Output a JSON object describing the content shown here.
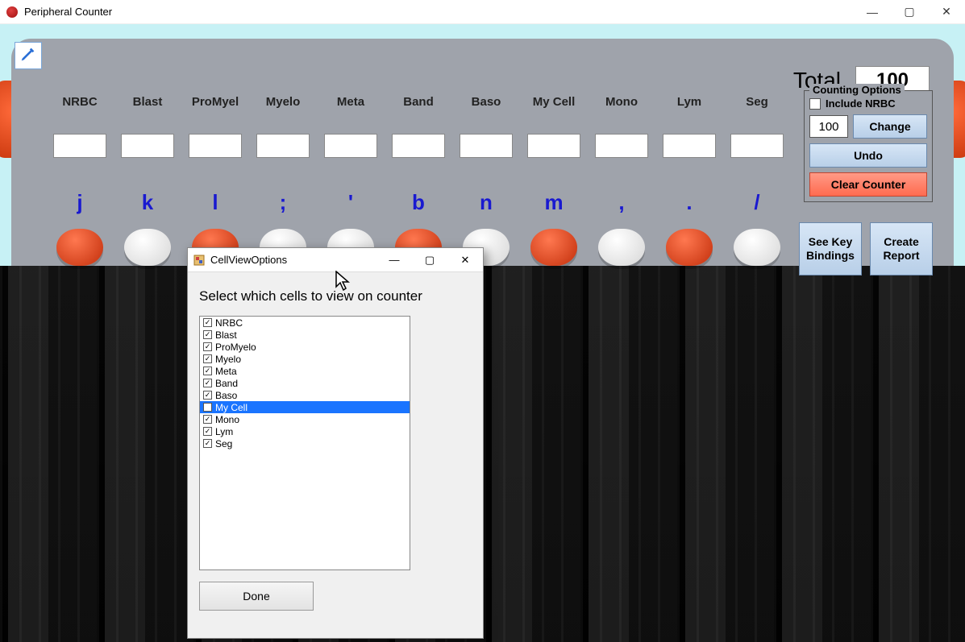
{
  "window": {
    "title": "Peripheral Counter",
    "controls": {
      "min": "—",
      "max": "▢",
      "close": "✕"
    }
  },
  "total": {
    "label": "Total",
    "value": "100"
  },
  "cells": [
    {
      "label": "NRBC",
      "key": "j",
      "btn": "red"
    },
    {
      "label": "Blast",
      "key": "k",
      "btn": "white"
    },
    {
      "label": "ProMyel",
      "key": "l",
      "btn": "red"
    },
    {
      "label": "Myelo",
      "key": ";",
      "btn": "white"
    },
    {
      "label": "Meta",
      "key": "'",
      "btn": "white"
    },
    {
      "label": "Band",
      "key": "b",
      "btn": "red"
    },
    {
      "label": "Baso",
      "key": "n",
      "btn": "white"
    },
    {
      "label": "My Cell",
      "key": "m",
      "btn": "red"
    },
    {
      "label": "Mono",
      "key": ",",
      "btn": "white"
    },
    {
      "label": "Lym",
      "key": ".",
      "btn": "red"
    },
    {
      "label": "Seg",
      "key": "/",
      "btn": "white"
    }
  ],
  "options": {
    "legend": "Counting Options",
    "include_nrbc_label": "Include NRBC",
    "count_target": "100",
    "change_label": "Change",
    "undo_label": "Undo",
    "clear_label": "Clear Counter"
  },
  "big_buttons": {
    "key_bindings": "See Key\nBindings",
    "create_report": "Create\nReport"
  },
  "dialog": {
    "title": "CellViewOptions",
    "heading": "Select which cells to view on counter",
    "items": [
      {
        "label": "NRBC",
        "checked": true,
        "selected": false
      },
      {
        "label": "Blast",
        "checked": true,
        "selected": false
      },
      {
        "label": "ProMyelo",
        "checked": true,
        "selected": false
      },
      {
        "label": "Myelo",
        "checked": true,
        "selected": false
      },
      {
        "label": "Meta",
        "checked": true,
        "selected": false
      },
      {
        "label": "Band",
        "checked": true,
        "selected": false
      },
      {
        "label": "Baso",
        "checked": true,
        "selected": false
      },
      {
        "label": "My Cell",
        "checked": false,
        "selected": true
      },
      {
        "label": "Mono",
        "checked": true,
        "selected": false
      },
      {
        "label": "Lym",
        "checked": true,
        "selected": false
      },
      {
        "label": "Seg",
        "checked": true,
        "selected": false
      }
    ],
    "done_label": "Done",
    "controls": {
      "min": "—",
      "max": "▢",
      "close": "✕"
    }
  }
}
